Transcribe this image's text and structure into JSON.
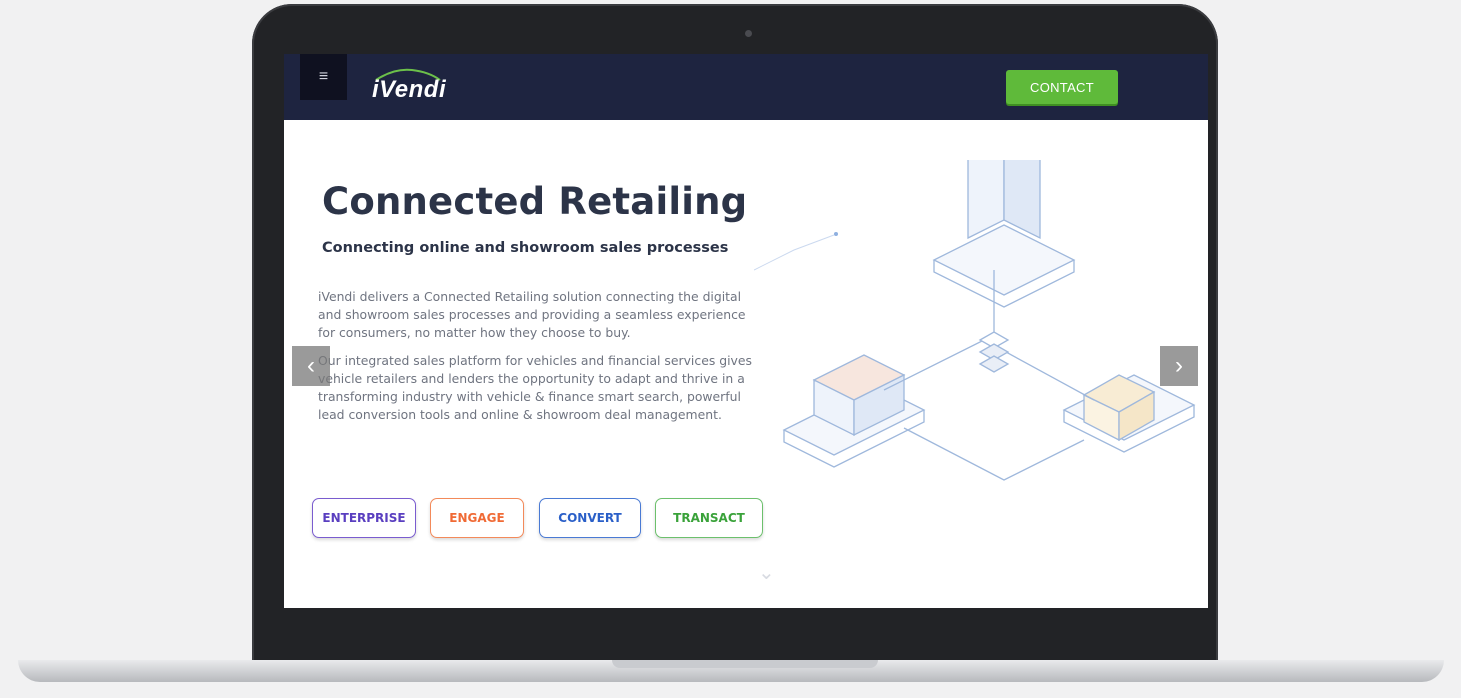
{
  "nav": {
    "menu_icon": "hamburger-icon",
    "logo_text": "iVendi",
    "contact_label": "CONTACT"
  },
  "hero": {
    "title": "Connected Retailing",
    "subtitle": "Connecting online and showroom sales processes",
    "paragraph1": "iVendi delivers a Connected Retailing solution connecting the digital and showroom sales processes and providing a seamless experience for consumers, no matter how they choose to buy.",
    "paragraph2": "Our integrated sales platform for vehicles and financial services gives vehicle retailers and lenders the opportunity to adapt and thrive in a transforming industry with vehicle & finance smart search, powerful lead conversion tools and online & showroom deal management."
  },
  "buttons": {
    "enterprise": "ENTERPRISE",
    "engage": "ENGAGE",
    "convert": "CONVERT",
    "transact": "TRANSACT"
  },
  "carousel": {
    "prev_glyph": "‹",
    "next_glyph": "›",
    "scroll_glyph": "⌄"
  },
  "colors": {
    "navbar": "#1e2440",
    "contact": "#5fba3a",
    "enterprise": "#5a3fc0",
    "engage": "#f06a35",
    "convert": "#2a5fc8",
    "transact": "#3aa23a"
  }
}
